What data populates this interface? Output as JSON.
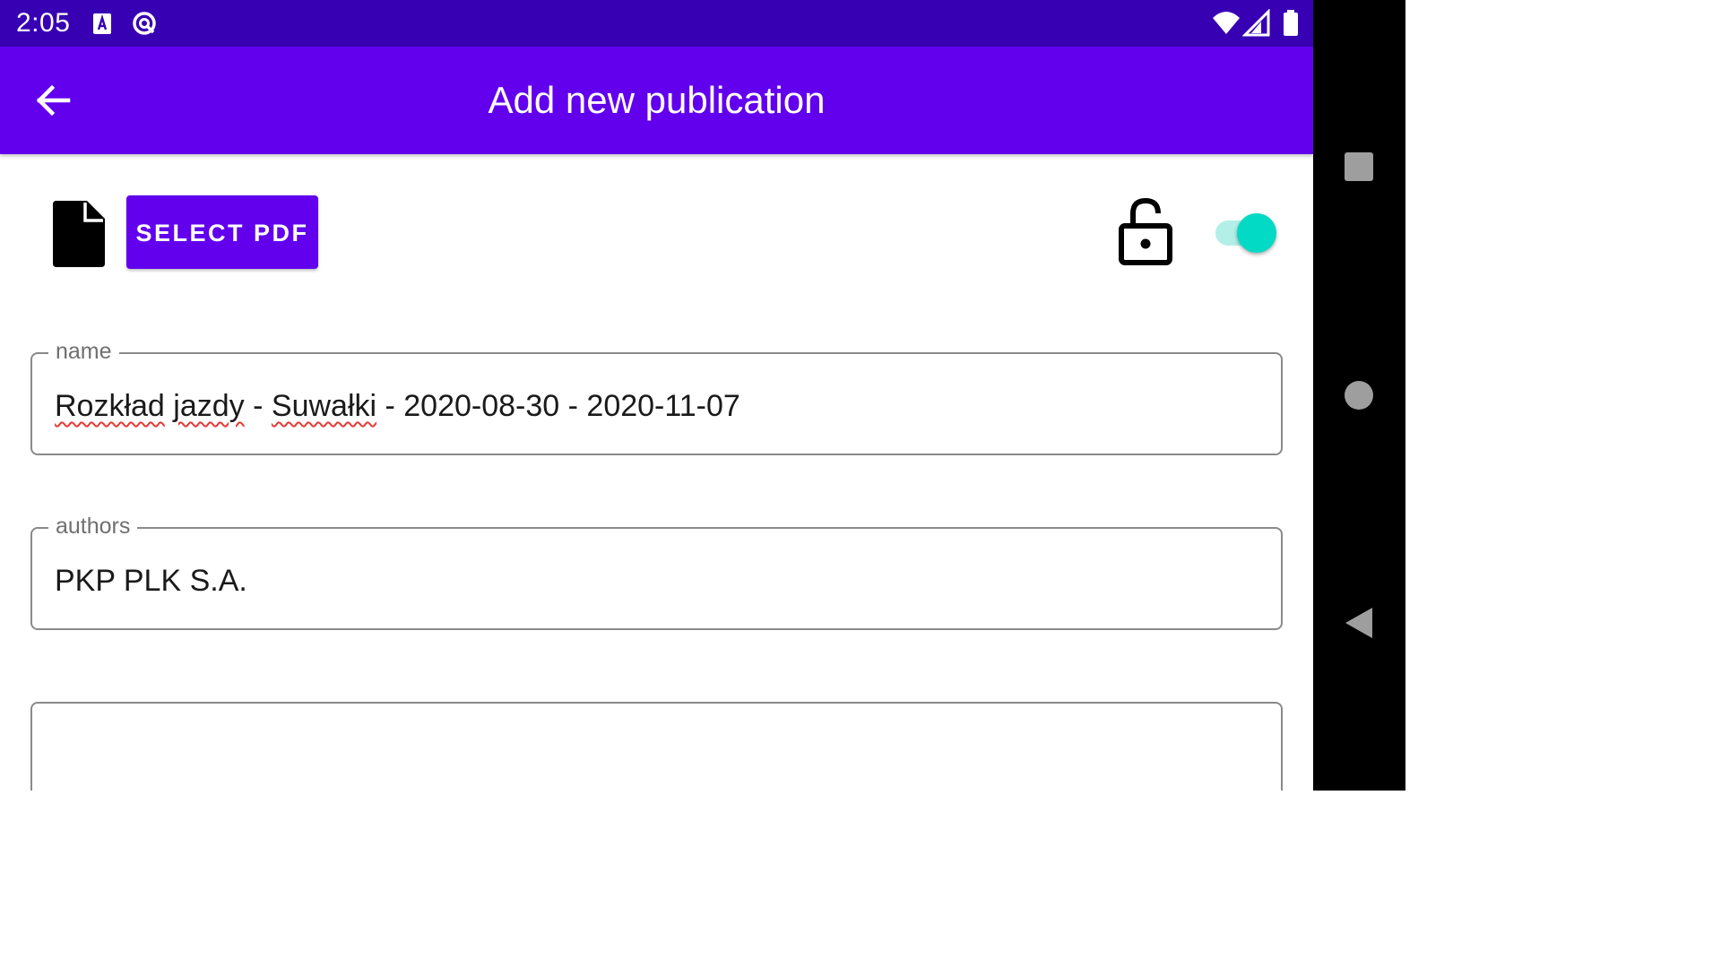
{
  "status_bar": {
    "time": "2:05",
    "icons": [
      "sim-card-icon",
      "data-saver-icon",
      "wifi-icon",
      "signal-icon",
      "battery-icon"
    ]
  },
  "app_bar": {
    "title": "Add new publication",
    "back_icon": "arrow-back-icon"
  },
  "toolbar": {
    "file_icon": "file-icon",
    "select_pdf_label": "SELECT PDF",
    "lock_icon": "lock-open-icon",
    "toggle_on": true
  },
  "form": {
    "name": {
      "label": "name",
      "value_parts": [
        "Rozkład",
        " ",
        "jazdy",
        " - ",
        "Suwałki",
        " - 2020-08-30 - 2020-11-07"
      ]
    },
    "authors": {
      "label": "authors",
      "value": "PKP PLK S.A."
    },
    "third": {
      "label": "",
      "value": ""
    }
  },
  "nav_bar": {
    "icons": [
      "recents-icon",
      "home-icon",
      "back-icon"
    ]
  },
  "colors": {
    "status_bar": "#3700b3",
    "primary": "#6200ee",
    "accent": "#03dac5",
    "toggle_track": "#b2efe7",
    "spellcheck": "#e53935"
  }
}
